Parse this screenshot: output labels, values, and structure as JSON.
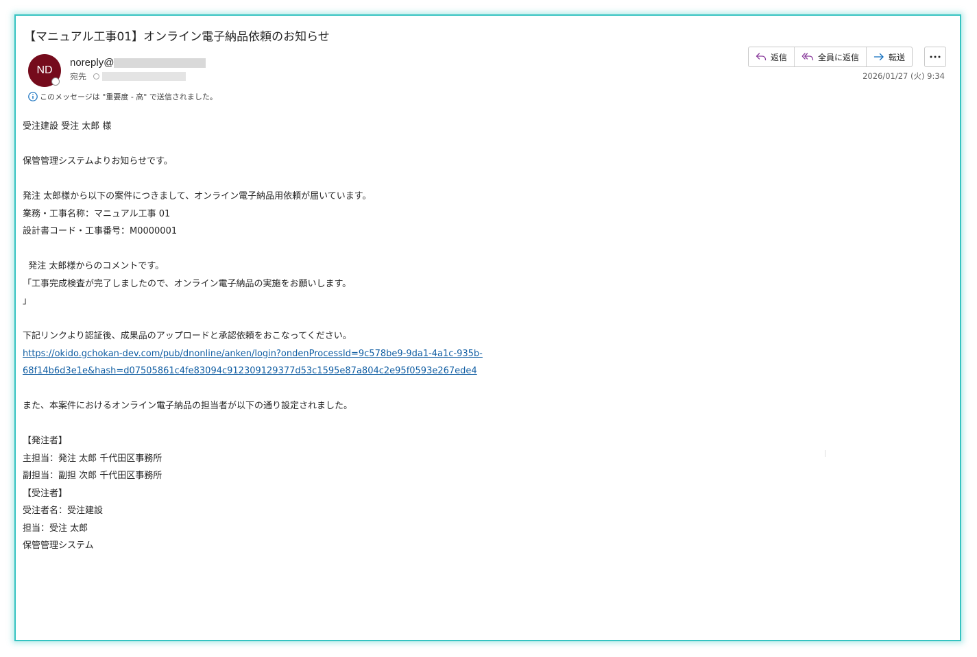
{
  "message": {
    "subject": "【マニュアル工事01】オンライン電子納品依頼のお知らせ",
    "avatar_initials": "ND",
    "sender_prefix": "noreply@",
    "to_label": "宛先",
    "importance_notice": "このメッセージは \"重要度 - 高\" で送信されました。",
    "date": "2026/01/27 (火) 9:34"
  },
  "actions": {
    "reply": "返信",
    "reply_all": "全員に返信",
    "forward": "転送"
  },
  "body": {
    "greeting": "受注建設 受注 太郎 様",
    "intro": "保管管理システムよりお知らせです。",
    "request": "発注 太郎様から以下の案件につきまして、オンライン電子納品用依頼が届いています。",
    "project_name": "業務・工事名称：マニュアル工事 01",
    "project_code": "設計書コード・工事番号：M0000001",
    "comment_header": "  発注 太郎様からのコメントです。",
    "comment_text": "「工事完成検査が完了しましたので、オンライン電子納品の実施をお願いします。",
    "comment_close": "」",
    "link_instruction": "下記リンクより認証後、成果品のアップロードと承認依頼をおこなってください。",
    "link_line1": "https://okido.gchokan-dev.com/pub/dnonline/anken/login?ondenProcessId=9c578be9-9da1-4a1c-935b-",
    "link_line2": "68f14b6d3e1e&hash=d07505861c4fe83094c912309129377d53c1595e87a804c2e95f0593e267ede4",
    "assignment_notice": "また、本案件におけるオンライン電子納品の担当者が以下の通り設定されました。",
    "orderer_header": "【発注者】",
    "orderer_main": "主担当：発注 太郎 千代田区事務所",
    "orderer_sub": "副担当：副担 次郎 千代田区事務所",
    "contractor_header": "【受注者】",
    "contractor_name": "受注者名：受注建設",
    "contractor_person": "担当：受注 太郎",
    "signature": "保管管理システム"
  },
  "colors": {
    "frame": "#35c3c1",
    "avatar": "#750b1c",
    "link": "#115ea3",
    "icon_accent": "#8a3c9c"
  }
}
